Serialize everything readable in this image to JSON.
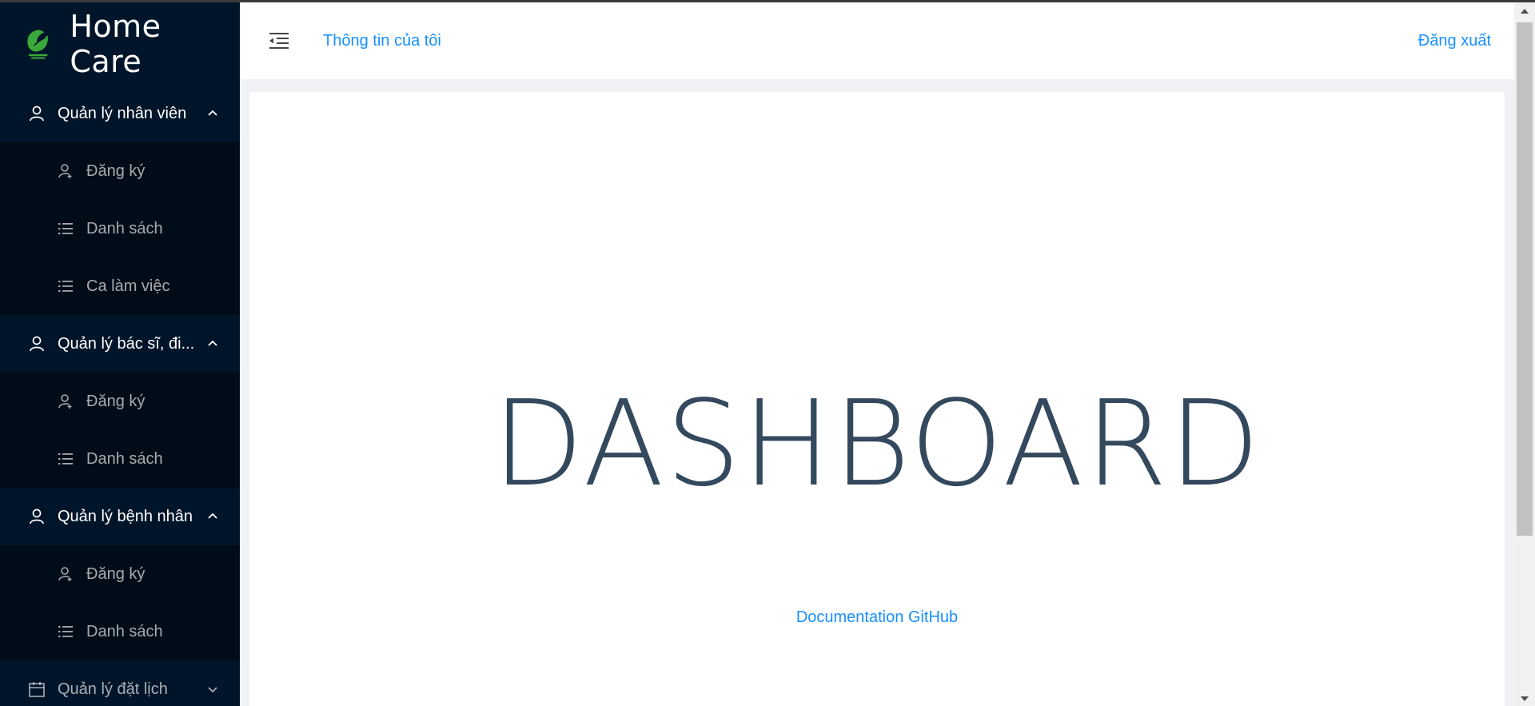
{
  "app": {
    "name": "Home Care"
  },
  "header": {
    "my_info": "Thông tin của tôi",
    "logout": "Đăng xuất"
  },
  "sidebar": {
    "groups": [
      {
        "label": "Quản lý nhân viên",
        "icon": "user-icon",
        "expanded": true,
        "items": [
          {
            "label": "Đăng ký",
            "icon": "user-add-icon"
          },
          {
            "label": "Danh sách",
            "icon": "list-icon"
          },
          {
            "label": "Ca làm việc",
            "icon": "list-icon"
          }
        ]
      },
      {
        "label": "Quản lý bác sĩ, đi...",
        "icon": "user-icon",
        "expanded": true,
        "items": [
          {
            "label": "Đăng ký",
            "icon": "user-add-icon"
          },
          {
            "label": "Danh sách",
            "icon": "list-icon"
          }
        ]
      },
      {
        "label": "Quản lý bệnh nhân",
        "icon": "user-icon",
        "expanded": true,
        "items": [
          {
            "label": "Đăng ký",
            "icon": "user-add-icon"
          },
          {
            "label": "Danh sách",
            "icon": "list-icon"
          }
        ]
      },
      {
        "label": "Quản lý đặt lịch",
        "icon": "calendar-icon",
        "expanded": false,
        "items": []
      }
    ]
  },
  "main": {
    "title": "DASHBOARD",
    "doc_link": "Documentation GitHub"
  },
  "colors": {
    "sidebar_bg": "#001529",
    "submenu_bg": "#000c17",
    "link": "#1890ff",
    "title": "#34495e",
    "logo_green": "#3aa93a"
  }
}
